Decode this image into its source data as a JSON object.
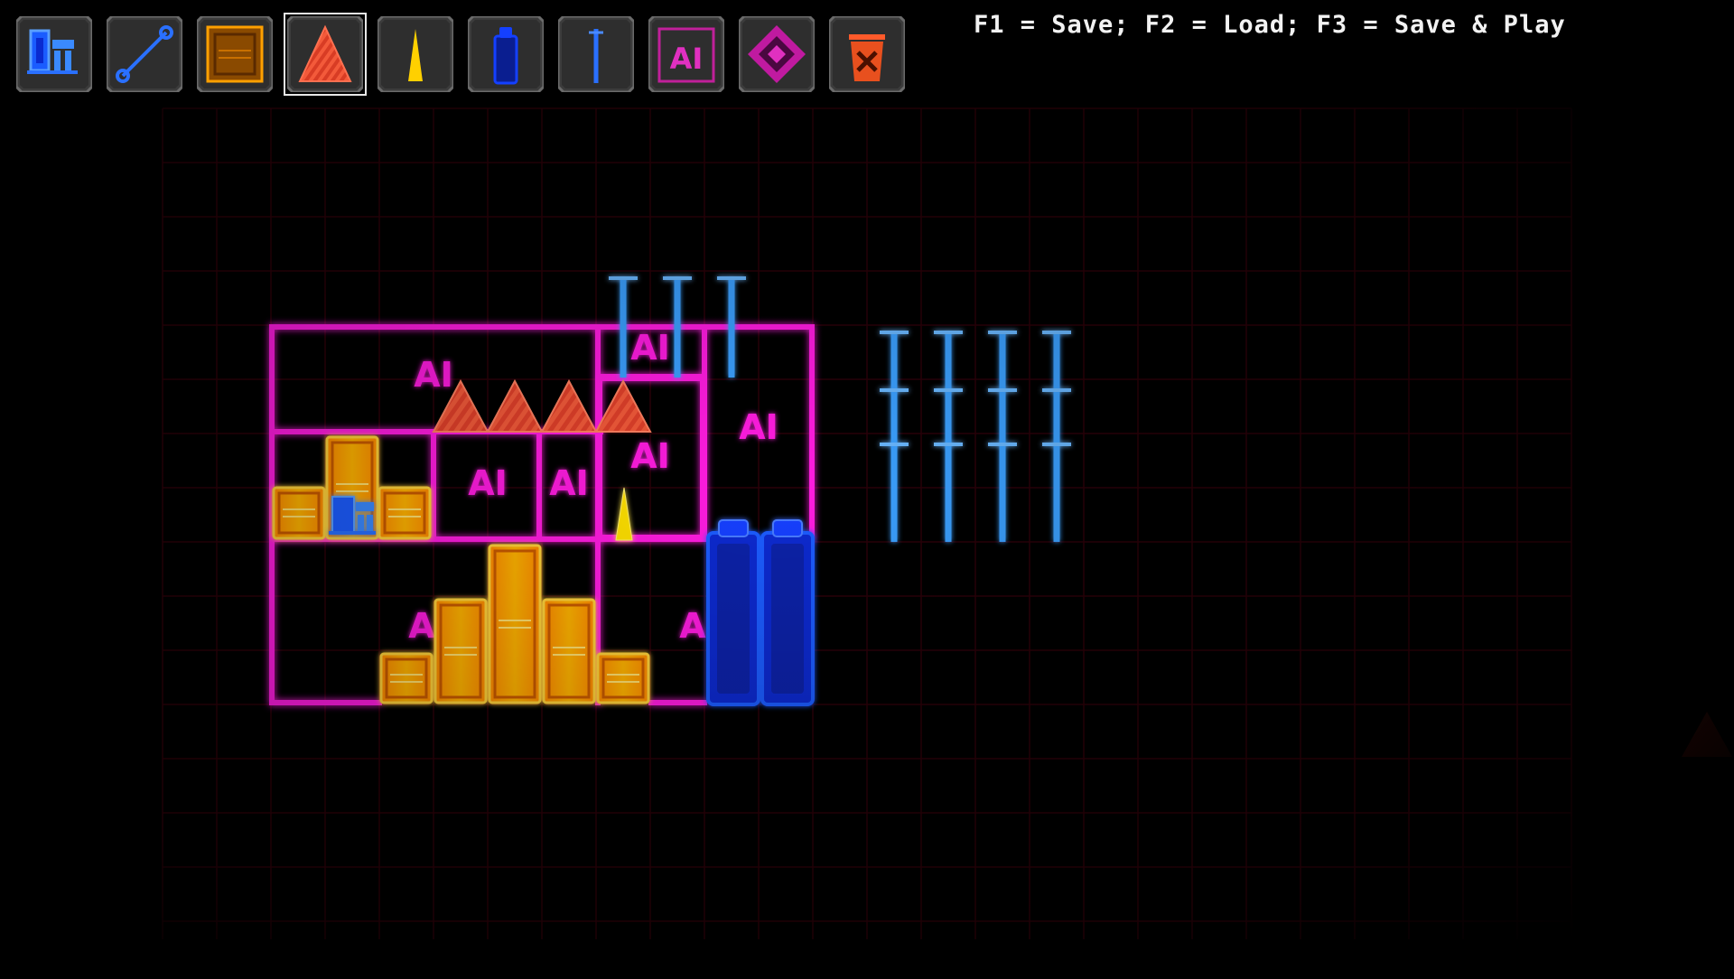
{
  "hint_text": "F1 = Save; F2 = Load; F3 = Save & Play",
  "toolbar": {
    "selected_index": 3,
    "tools": [
      {
        "icon": "player-robot-icon"
      },
      {
        "icon": "link-line-icon"
      },
      {
        "icon": "crate-icon"
      },
      {
        "icon": "spike-icon"
      },
      {
        "icon": "yellow-spike-icon"
      },
      {
        "icon": "blue-canister-icon"
      },
      {
        "icon": "antenna-pole-icon"
      },
      {
        "icon": "ai-block-icon"
      },
      {
        "icon": "diamond-target-icon"
      },
      {
        "icon": "trash-icon"
      }
    ]
  },
  "level": {
    "ai_label": "AI"
  },
  "colors": {
    "magenta": "#ff1fe0",
    "orange": "#ffa000",
    "blue": "#1a5cff",
    "cyan_blue": "#3aa0ff",
    "red_spike": "#ff5a3a",
    "yellow": "#ffe000",
    "grid": "#2a0008"
  }
}
